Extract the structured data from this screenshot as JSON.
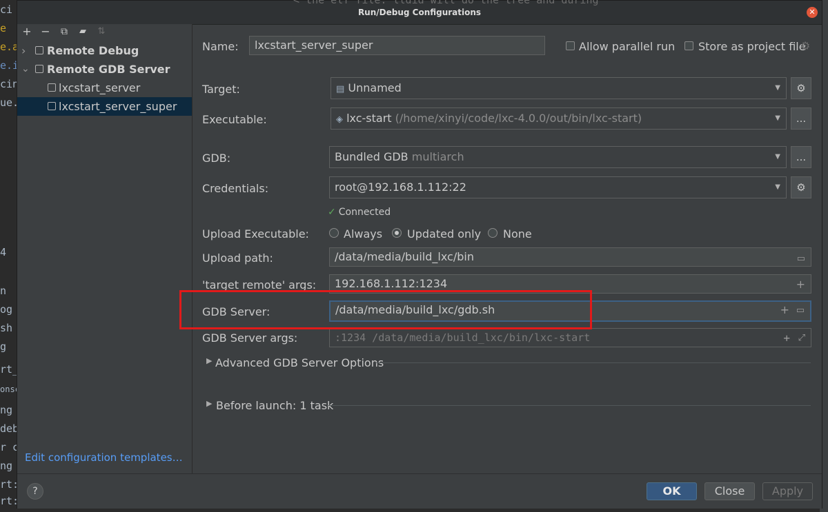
{
  "background": {
    "left_fragments": [
      "ci",
      "e",
      "e.ar",
      "e.in",
      "cine",
      "ue.",
      "4",
      "n",
      "og",
      "sh",
      "g",
      "rt_s",
      "onsc",
      "ng",
      "deb",
      "r c",
      "ng",
      "rt:",
      "rt:"
    ],
    "title_fragment": "< the elf file. lldid will do the tree and during"
  },
  "dialog": {
    "title": "Run/Debug Configurations",
    "close_icon": "close-icon"
  },
  "toolbar": {
    "add": "+",
    "remove": "−",
    "copy": "⧉",
    "folder": "▰",
    "sort": "⇅"
  },
  "tree": {
    "items": [
      {
        "label": "Remote Debug",
        "arrow": "›"
      },
      {
        "label": "Remote GDB Server",
        "arrow": "⌄"
      },
      {
        "label": "lxcstart_server"
      },
      {
        "label": "lxcstart_server_super"
      }
    ]
  },
  "edit_templates_link": "Edit configuration templates…",
  "form": {
    "name_label": "Name:",
    "name_value": "lxcstart_server_super",
    "allow_parallel_label": "Allow parallel run",
    "store_project_label": "Store as project file",
    "target_label": "Target:",
    "target_value": "Unnamed",
    "executable_label": "Executable:",
    "executable_value": "lxc-start",
    "executable_path": "(/home/xinyi/code/lxc-4.0.0/out/bin/lxc-start)",
    "gdb_label": "GDB:",
    "gdb_value": "Bundled GDB",
    "gdb_hint": "multiarch",
    "credentials_label": "Credentials:",
    "credentials_value": "root@192.168.1.112:22",
    "connected_text": "Connected",
    "upload_exec_label": "Upload Executable:",
    "upload_options": [
      "Always",
      "Updated only",
      "None"
    ],
    "upload_selected": "Updated only",
    "upload_path_label": "Upload path:",
    "upload_path_value": "/data/media/build_lxc/bin",
    "target_remote_label": "'target remote' args:",
    "target_remote_value": "192.168.1.112:1234",
    "gdb_server_label": "GDB Server:",
    "gdb_server_value": "/data/media/build_lxc/gdb.sh",
    "gdb_server_args_label": "GDB Server args:",
    "gdb_server_args_value": ":1234 /data/media/build_lxc/bin/lxc-start",
    "advanced_label": "Advanced GDB Server Options",
    "before_launch_label": "Before launch: 1 task",
    "ellipsis": "...",
    "gear": "⚙"
  },
  "buttons": {
    "help": "?",
    "ok": "OK",
    "close": "Close",
    "apply": "Apply"
  },
  "colors": {
    "accent": "#365880",
    "highlight_box": "#e21a1a",
    "selection": "#0d293e",
    "link": "#589df6"
  }
}
